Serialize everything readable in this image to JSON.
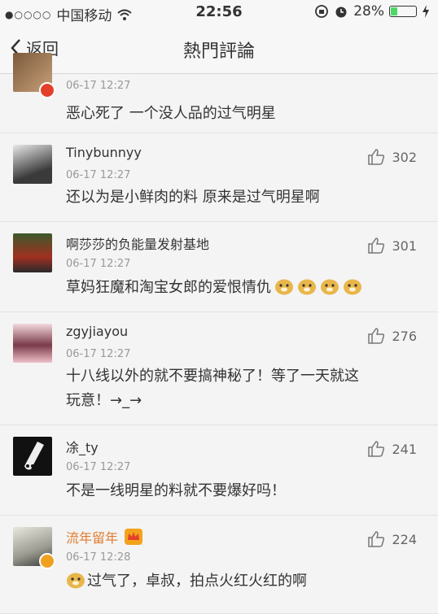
{
  "status": {
    "dots": "●○○○○",
    "carrier": "中国移动",
    "time": "22:56",
    "battery": "28%",
    "battery_level": 0.28
  },
  "nav": {
    "back_label": "返回",
    "title": "熱門評論"
  },
  "comments": [
    {
      "time": "06-17 12:27",
      "text": "恶心死了 一个没人品的过气明星"
    },
    {
      "name": "Tinybunnyy",
      "time": "06-17 12:27",
      "likes": "302",
      "text": "还以为是小鲜肉的料 原来是过气明星啊"
    },
    {
      "name": "啊莎莎的负能量发射基地",
      "time": "06-17 12:27",
      "likes": "301",
      "text": "草妈狂魔和淘宝女郎的爱恨情仇"
    },
    {
      "name": "zgyjiayou",
      "time": "06-17 12:27",
      "likes": "276",
      "text_line1": "十八线以外的就不要搞神秘了！等了一天就这",
      "text_line2": "玩意！→_→"
    },
    {
      "name": "凃_ty",
      "time": "06-17 12:27",
      "likes": "241",
      "text": "不是一线明星的料就不要爆好吗！"
    },
    {
      "name": "流年留年",
      "time": "06-17 12:28",
      "likes": "224",
      "text": "过气了，卓叔，拍点火红火红的啊"
    }
  ],
  "colors": {
    "vip_name": "#e07b2e",
    "verified_badge": "#f0a020",
    "red_badge": "#e2402a"
  }
}
